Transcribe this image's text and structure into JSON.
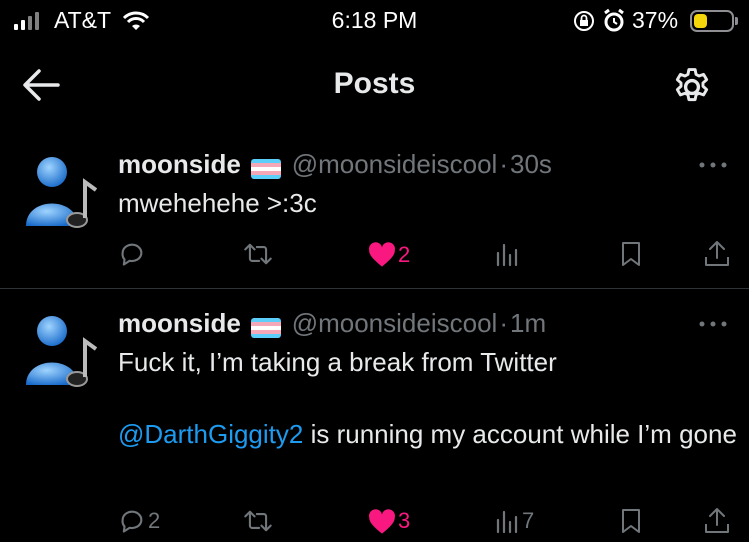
{
  "status_bar": {
    "carrier": "AT&T",
    "time": "6:18 PM",
    "battery_percent": "37%",
    "battery_level": 0.37,
    "battery_color": "#f5d60a"
  },
  "header": {
    "title": "Posts",
    "back_icon": "arrow-left-icon",
    "settings_icon": "gear-icon"
  },
  "posts": [
    {
      "name": "moonside",
      "handle": "@moonsideiscool",
      "sep": "·",
      "time": "30s",
      "text": "mwehehehe >:3c",
      "mention": "",
      "text_after_mention": "",
      "replies": "",
      "reposts": "",
      "likes": "2",
      "views": "",
      "liked": true
    },
    {
      "name": "moonside",
      "handle": "@moonsideiscool",
      "sep": "·",
      "time": "1m",
      "text": "Fuck it, I’m taking a break from Twitter",
      "mention": "@DarthGiggity2",
      "text_after_mention": " is running my account while I’m gone",
      "replies": "2",
      "reposts": "",
      "likes": "3",
      "views": "7",
      "liked": true
    }
  ],
  "colors": {
    "accent_blue": "#1d9bf0",
    "like_pink": "#f91880",
    "muted": "#71767b",
    "trans_flag": [
      "#5bcefa",
      "#f5a9b8",
      "#ffffff",
      "#f5a9b8",
      "#5bcefa"
    ]
  }
}
